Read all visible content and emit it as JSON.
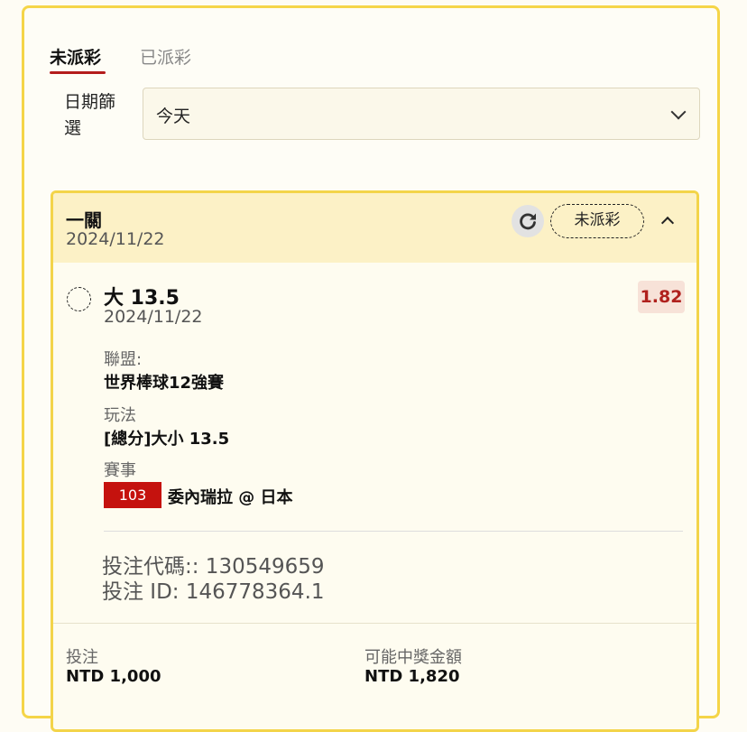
{
  "tabs": [
    {
      "label": "未派彩",
      "active": true
    },
    {
      "label": "已派彩",
      "active": false
    }
  ],
  "filter": {
    "label": "日期篩選",
    "value": "今天"
  },
  "card": {
    "title": "一關",
    "date": "2024/11/22",
    "status": "未派彩",
    "pick": "大 13.5",
    "pick_date": "2024/11/22",
    "odds": "1.82",
    "league_label": "聯盟:",
    "league": "世界棒球12強賽",
    "play_label": "玩法",
    "play": "[總分]大小 13.5",
    "event_label": "賽事",
    "event_code": "103",
    "event_name": "委內瑞拉 @ 日本",
    "bet_code": "投注代碼:: 130549659",
    "bet_id": "投注 ID: 146778364.1",
    "stake_label": "投注",
    "stake": "NTD 1,000",
    "payout_label": "可能中獎金額",
    "payout": "NTD 1,820"
  },
  "colors": {
    "accent": "#b41c1c",
    "border": "#f3d44a",
    "header_bg": "#fcf1c6",
    "badge": "#c5120e"
  },
  "icons": [
    "chevron-down-icon",
    "refresh-icon",
    "chevron-up-icon",
    "selection-circle-icon"
  ]
}
